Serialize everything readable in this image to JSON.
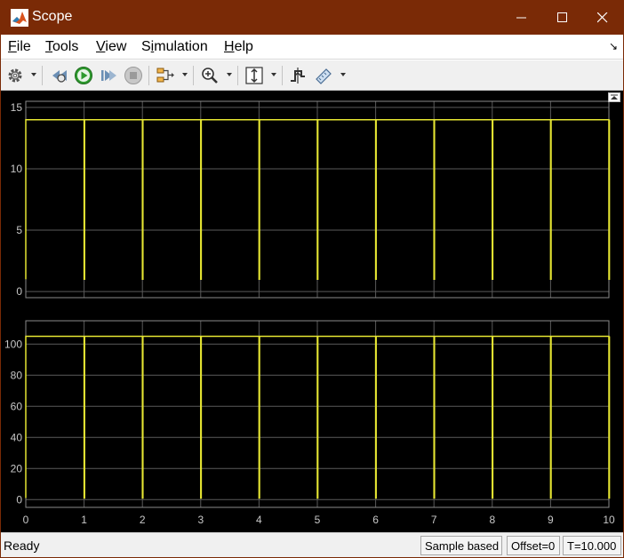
{
  "window": {
    "title": "Scope",
    "icon": "matlab-icon",
    "controls": [
      "minimize-icon",
      "maximize-icon",
      "close-icon"
    ]
  },
  "menu": {
    "items": [
      {
        "label": "File",
        "mnemonic": "F"
      },
      {
        "label": "Tools",
        "mnemonic": "T"
      },
      {
        "label": "View",
        "mnemonic": "V"
      },
      {
        "label": "Simulation",
        "mnemonic": "i"
      },
      {
        "label": "Help",
        "mnemonic": "H"
      }
    ],
    "dock_arrow": "↘"
  },
  "toolbar": {
    "items": [
      "settings-icon",
      "step-back-icon",
      "run-icon",
      "step-forward-icon",
      "stop-icon",
      "signal-selector-icon",
      "zoom-in-icon",
      "autoscale-icon",
      "triggers-icon",
      "measurements-icon"
    ]
  },
  "colors": {
    "title_bar": "#7a2a06",
    "plot_background": "#000000",
    "signal": "#e6e632",
    "grid": "#5a5a5a",
    "axis_text": "#c8c8c8"
  },
  "chart_data": [
    {
      "type": "line",
      "title": "",
      "xlabel": "",
      "ylabel": "",
      "xlim": [
        0,
        10
      ],
      "ylim": [
        -0.5,
        15.5
      ],
      "yticks": [
        0,
        5,
        10,
        15
      ],
      "xticks": [],
      "grid": true,
      "series": [
        {
          "color": "#e6e632",
          "high": 14,
          "low": 1,
          "pulse_times": [
            0,
            1,
            2,
            3,
            4,
            5,
            6,
            7,
            8,
            9,
            10
          ]
        }
      ]
    },
    {
      "type": "line",
      "title": "",
      "xlabel": "",
      "ylabel": "",
      "xlim": [
        0,
        10
      ],
      "ylim": [
        -5,
        115
      ],
      "yticks": [
        0,
        20,
        40,
        60,
        80,
        100
      ],
      "xticks": [
        0,
        1,
        2,
        3,
        4,
        5,
        6,
        7,
        8,
        9,
        10
      ],
      "grid": true,
      "series": [
        {
          "color": "#e6e632",
          "high": 105,
          "low": 1,
          "pulse_times": [
            0,
            1,
            2,
            3,
            4,
            5,
            6,
            7,
            8,
            9,
            10
          ]
        }
      ]
    }
  ],
  "status": {
    "text": "Ready",
    "sample_mode": "Sample based",
    "offset": "Offset=0",
    "time": "T=10.000"
  }
}
